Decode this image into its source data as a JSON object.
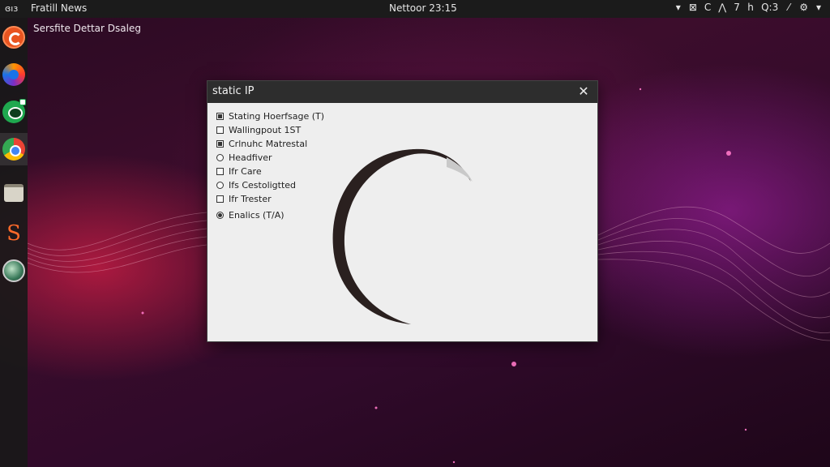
{
  "top_panel": {
    "activities": "ɞıз",
    "app_name": "Fratill News",
    "clock": "Nettoor 23:15",
    "tray": [
      "▾",
      "⊠",
      "C",
      "⋀",
      "7",
      "h",
      "Q:3",
      "⁄",
      "⚙",
      "▾"
    ]
  },
  "desktop": {
    "label": "Sersfite Dettar Dsaleg"
  },
  "dock": {
    "items": [
      {
        "icon": "ubuntu-icon"
      },
      {
        "icon": "firefox-icon"
      },
      {
        "icon": "chat-icon"
      },
      {
        "icon": "browser-icon"
      },
      {
        "icon": "files-icon"
      },
      {
        "icon": "s-app-icon",
        "glyph": "S"
      },
      {
        "icon": "globe-icon"
      }
    ]
  },
  "dialog": {
    "title": "static IP",
    "close": "✕",
    "options": [
      {
        "label": "Stating Hoerfsage (T)",
        "kind": "checkbox",
        "checked": true
      },
      {
        "label": "Wallingpout 1ST",
        "kind": "checkbox",
        "checked": false
      },
      {
        "label": "Crlnuhc Matrestal",
        "kind": "checkbox",
        "checked": true
      },
      {
        "label": "Headfiver",
        "kind": "radio",
        "checked": false
      },
      {
        "label": "Ifr Care",
        "kind": "checkbox",
        "checked": false
      },
      {
        "label": "Ifs Cestoligtted",
        "kind": "radio",
        "checked": false
      },
      {
        "label": "Ifr Trester",
        "kind": "checkbox",
        "checked": false
      },
      {
        "label": "Enalics (T/A)",
        "kind": "radio",
        "checked": true
      }
    ]
  },
  "colors": {
    "panel": "#1b1b1b",
    "dialog_header": "#2d2d2d",
    "dialog_body": "#eeeeee",
    "accent": "#e95420"
  }
}
